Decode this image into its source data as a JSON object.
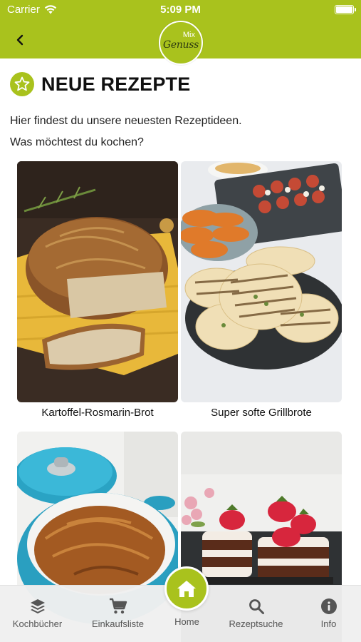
{
  "status_bar": {
    "carrier": "Carrier",
    "time": "5:09 PM"
  },
  "nav": {
    "logo_top": "Mix",
    "logo_main": "Genuss"
  },
  "colors": {
    "brand": "#a9c21d",
    "text": "#111111",
    "tab_text": "#555555"
  },
  "page": {
    "title": "NEUE REZEPTE",
    "intro_line_1": "Hier findest du unsere neuesten Rezeptideen.",
    "intro_line_2": "Was möchtest du kochen?"
  },
  "recipes": [
    {
      "title": "Kartoffel-Rosmarin-Brot"
    },
    {
      "title": "Super softe Grillbrote"
    },
    {
      "title": ""
    },
    {
      "title": ""
    }
  ],
  "tabbar": {
    "items": [
      {
        "label": "Kochbücher",
        "icon": "layers-icon"
      },
      {
        "label": "Einkaufsliste",
        "icon": "cart-icon"
      },
      {
        "label": "Home",
        "icon": "home-icon"
      },
      {
        "label": "Rezeptsuche",
        "icon": "search-icon"
      },
      {
        "label": "Info",
        "icon": "info-icon"
      }
    ]
  }
}
